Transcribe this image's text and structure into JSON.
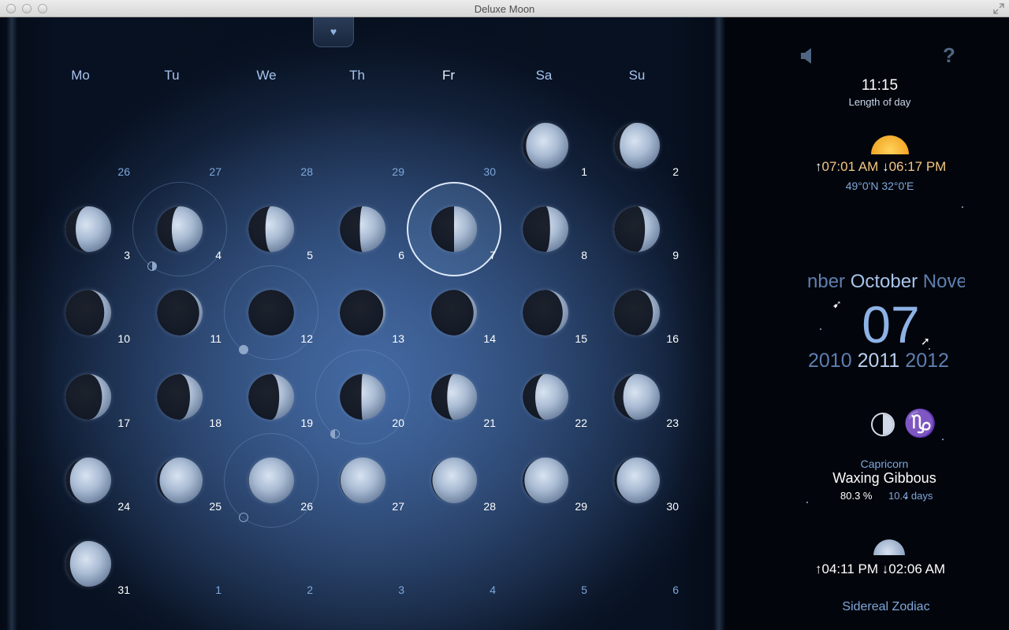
{
  "window": {
    "title": "Deluxe Moon"
  },
  "calendar": {
    "weekdays": [
      "Mo",
      "Tu",
      "We",
      "Th",
      "Fr",
      "Sa",
      "Su"
    ],
    "today_weekday_index": 4,
    "rows": [
      [
        {
          "d": "26",
          "o": true,
          "m": false
        },
        {
          "d": "27",
          "o": true,
          "m": false
        },
        {
          "d": "28",
          "o": true,
          "m": false
        },
        {
          "d": "29",
          "o": true,
          "m": false
        },
        {
          "d": "30",
          "o": true,
          "m": false
        },
        {
          "d": "1",
          "o": false,
          "m": true,
          "p": -0.85
        },
        {
          "d": "2",
          "o": false,
          "m": true,
          "p": -0.75
        }
      ],
      [
        {
          "d": "3",
          "o": false,
          "m": true,
          "p": -0.55
        },
        {
          "d": "4",
          "o": false,
          "m": true,
          "p": -0.35,
          "ring": true,
          "mark": "first-quarter"
        },
        {
          "d": "5",
          "o": false,
          "m": true,
          "p": -0.25
        },
        {
          "d": "6",
          "o": false,
          "m": true,
          "p": -0.12
        },
        {
          "d": "7",
          "o": false,
          "m": true,
          "p": 0.0,
          "sel": true
        },
        {
          "d": "8",
          "o": false,
          "m": true,
          "p": 0.2
        },
        {
          "d": "9",
          "o": false,
          "m": true,
          "p": 0.35
        }
      ],
      [
        {
          "d": "10",
          "o": false,
          "m": true,
          "p": 0.7
        },
        {
          "d": "11",
          "o": false,
          "m": true,
          "p": 0.85
        },
        {
          "d": "12",
          "o": false,
          "m": true,
          "p": 1.0,
          "ring": true,
          "mark": "full"
        },
        {
          "d": "13",
          "o": false,
          "m": true,
          "p": 0.9
        },
        {
          "d": "14",
          "o": false,
          "m": true,
          "p": 0.85
        },
        {
          "d": "15",
          "o": false,
          "m": true,
          "p": 0.75
        },
        {
          "d": "16",
          "o": false,
          "m": true,
          "p": 0.7
        }
      ],
      [
        {
          "d": "17",
          "o": false,
          "m": true,
          "p": 0.6
        },
        {
          "d": "18",
          "o": false,
          "m": true,
          "p": 0.45
        },
        {
          "d": "19",
          "o": false,
          "m": true,
          "p": 0.35
        },
        {
          "d": "20",
          "o": false,
          "m": true,
          "p": -0.05,
          "ring": true,
          "mark": "last-quarter"
        },
        {
          "d": "21",
          "o": false,
          "m": true,
          "p": -0.3
        },
        {
          "d": "22",
          "o": false,
          "m": true,
          "p": -0.45
        },
        {
          "d": "23",
          "o": false,
          "m": true,
          "p": -0.6
        }
      ],
      [
        {
          "d": "24",
          "o": false,
          "m": true,
          "p": -0.8
        },
        {
          "d": "25",
          "o": false,
          "m": true,
          "p": -0.88
        },
        {
          "d": "26",
          "o": false,
          "m": true,
          "p": -0.98,
          "ring": true,
          "mark": "new"
        },
        {
          "d": "27",
          "o": false,
          "m": true,
          "p": -0.97
        },
        {
          "d": "28",
          "o": false,
          "m": true,
          "p": -0.95
        },
        {
          "d": "29",
          "o": false,
          "m": true,
          "p": -0.92
        },
        {
          "d": "30",
          "o": false,
          "m": true,
          "p": -0.88
        }
      ],
      [
        {
          "d": "31",
          "o": false,
          "m": true,
          "p": -0.8
        },
        {
          "d": "1",
          "o": true,
          "m": false
        },
        {
          "d": "2",
          "o": true,
          "m": false
        },
        {
          "d": "3",
          "o": true,
          "m": false
        },
        {
          "d": "4",
          "o": true,
          "m": false
        },
        {
          "d": "5",
          "o": true,
          "m": false
        },
        {
          "d": "6",
          "o": true,
          "m": false
        }
      ]
    ]
  },
  "info": {
    "length_of_day_value": "11:15",
    "length_of_day_label": "Length of day",
    "sunrise": "07:01 AM",
    "sunset": "06:17 PM",
    "coordinates": "49°0'N 32°0'E",
    "months": {
      "prev": "nber",
      "current": "October",
      "next": "Nove"
    },
    "day": "07",
    "years": {
      "prev": "2010",
      "current": "2011",
      "next": "2012"
    },
    "zodiac_sign": "Capricorn",
    "phase_name": "Waxing Gibbous",
    "illumination": "80.3 %",
    "age": "10.4 days",
    "moonrise": "04:11 PM",
    "moonset": "02:06 AM",
    "footer_link": "Sidereal Zodiac"
  },
  "icons": {
    "arrow_up": "↑",
    "arrow_down": "↓",
    "pull_tab": "♥",
    "help": "?",
    "zodiac": "♑"
  },
  "colors": {
    "accent_blue": "#7fa7dc",
    "sun_orange": "#f3c784",
    "background": "#07101f"
  }
}
